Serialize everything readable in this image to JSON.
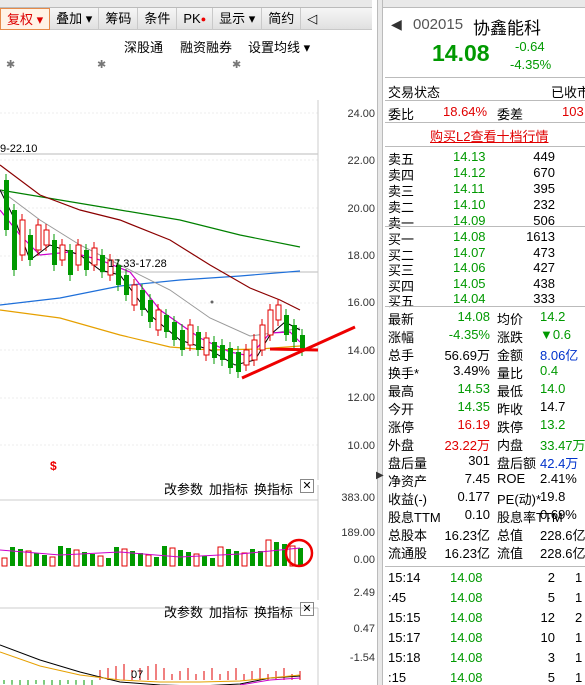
{
  "toolbar": {
    "items": [
      "复权",
      "叠加",
      "筹码",
      "条件",
      "PK",
      "显示",
      "简约"
    ],
    "sub": [
      "深股通",
      "融资融券",
      "设置均线"
    ]
  },
  "price_axis": [
    "24.00",
    "22.00",
    "20.00",
    "18.00",
    "16.00",
    "14.00",
    "12.00",
    "10.00"
  ],
  "chart_labels": {
    "left_top": "9-22.10",
    "mid": "17.33-17.28",
    "marker": "$",
    "xdate": "07"
  },
  "vol_panel": {
    "buttons": [
      "改参数",
      "加指标",
      "换指标"
    ],
    "axis": [
      "383.00",
      "189.00",
      "0.00"
    ]
  },
  "ind_panel": {
    "buttons": [
      "改参数",
      "加指标",
      "换指标"
    ],
    "axis": [
      "2.49",
      "0.47",
      "-1.54"
    ]
  },
  "quote": {
    "code": "002015",
    "name": "协鑫能科",
    "price": "14.08",
    "change": "-0.64",
    "pct": "-4.35%",
    "status_label": "交易状态",
    "status_right": "已收市",
    "ratio_label": "委比",
    "ratio": "18.64%",
    "diff_label": "委差",
    "diff": "103",
    "l2_link": "购买L2查看十档行情",
    "asks": [
      {
        "label": "卖五",
        "price": "14.13",
        "vol": "449"
      },
      {
        "label": "卖四",
        "price": "14.12",
        "vol": "670"
      },
      {
        "label": "卖三",
        "price": "14.11",
        "vol": "395"
      },
      {
        "label": "卖二",
        "price": "14.10",
        "vol": "232"
      },
      {
        "label": "卖一",
        "price": "14.09",
        "vol": "506"
      }
    ],
    "bids": [
      {
        "label": "买一",
        "price": "14.08",
        "vol": "1613"
      },
      {
        "label": "买二",
        "price": "14.07",
        "vol": "473"
      },
      {
        "label": "买三",
        "price": "14.06",
        "vol": "427"
      },
      {
        "label": "买四",
        "price": "14.05",
        "vol": "438"
      },
      {
        "label": "买五",
        "price": "14.04",
        "vol": "333"
      }
    ],
    "stats": [
      {
        "l1": "最新",
        "v1": "14.08",
        "c1": "g",
        "l2": "均价",
        "v2": "14.2",
        "c2": "g"
      },
      {
        "l1": "涨幅",
        "v1": "-4.35%",
        "c1": "g",
        "l2": "涨跌",
        "v2": "▼0.6",
        "c2": "g"
      },
      {
        "l1": "总手",
        "v1": "56.69万",
        "c1": "",
        "l2": "金额",
        "v2": "8.06亿",
        "c2": "b"
      },
      {
        "l1": "换手*",
        "v1": "3.49%",
        "c1": "",
        "l2": "量比",
        "v2": "0.4",
        "c2": "g"
      },
      {
        "l1": "最高",
        "v1": "14.53",
        "c1": "g",
        "l2": "最低",
        "v2": "14.0",
        "c2": "g"
      },
      {
        "l1": "今开",
        "v1": "14.35",
        "c1": "g",
        "l2": "昨收",
        "v2": "14.7",
        "c2": ""
      },
      {
        "l1": "涨停",
        "v1": "16.19",
        "c1": "r",
        "l2": "跌停",
        "v2": "13.2",
        "c2": "g"
      },
      {
        "l1": "外盘",
        "v1": "23.22万",
        "c1": "r",
        "l2": "内盘",
        "v2": "33.47万",
        "c2": "g"
      },
      {
        "l1": "盘后量",
        "v1": "301",
        "c1": "",
        "l2": "盘后额",
        "v2": "42.4万",
        "c2": "b"
      },
      {
        "l1": "净资产",
        "v1": "7.45",
        "c1": "",
        "l2": "ROE",
        "v2": "2.41%",
        "c2": ""
      },
      {
        "l1": "收益(-)",
        "v1": "0.177",
        "c1": "",
        "l2": "PE(动)*",
        "v2": "19.8",
        "c2": ""
      },
      {
        "l1": "股息TTM",
        "v1": "0.10",
        "c1": "",
        "l2": "股息率TTM",
        "v2": "0.69%",
        "c2": ""
      },
      {
        "l1": "总股本",
        "v1": "16.23亿",
        "c1": "",
        "l2": "总值",
        "v2": "228.6亿",
        "c2": ""
      },
      {
        "l1": "流通股",
        "v1": "16.23亿",
        "c1": "",
        "l2": "流值",
        "v2": "228.6亿",
        "c2": ""
      }
    ],
    "ticks": [
      {
        "t": "15:14",
        "p": "14.08",
        "v": "2",
        "x": "1"
      },
      {
        "t": ":45",
        "p": "14.08",
        "v": "5",
        "x": "1"
      },
      {
        "t": "15:15",
        "p": "14.08",
        "v": "12",
        "x": "2"
      },
      {
        "t": "15:17",
        "p": "14.08",
        "v": "10",
        "x": "1"
      },
      {
        "t": "15:18",
        "p": "14.08",
        "v": "3",
        "x": "1"
      },
      {
        "t": ":15",
        "p": "14.08",
        "v": "5",
        "x": "1"
      }
    ]
  },
  "colors": {
    "up": "#e00000",
    "down": "#009900",
    "ma5": "#000000",
    "ma10": "#cc00cc",
    "ma20": "#999999",
    "ma30": "#8b0000",
    "ma60": "#008000",
    "ma120": "#1e6fd9",
    "ma250": "#e6a000"
  }
}
